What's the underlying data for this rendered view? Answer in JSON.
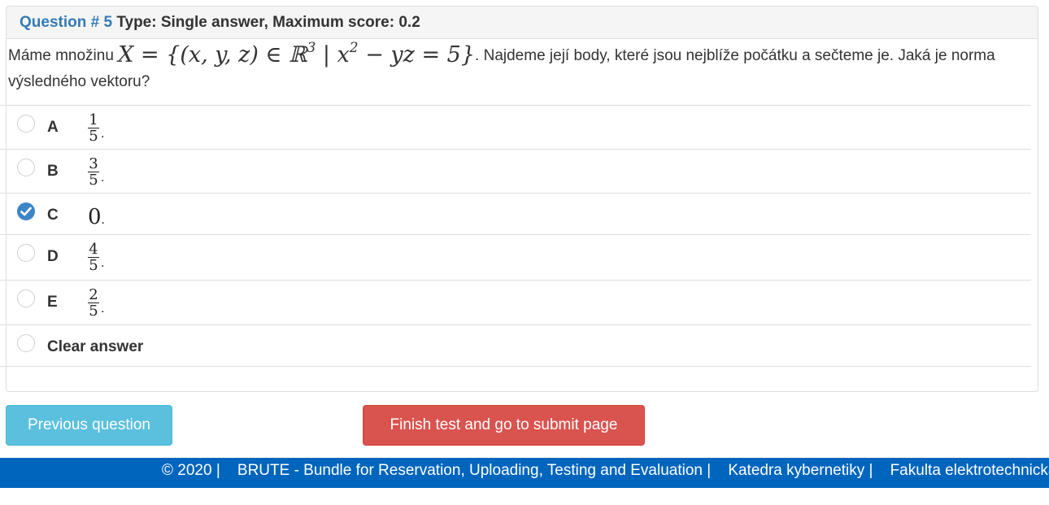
{
  "question": {
    "number_label": "Question # 5",
    "type_label": "Type: Single answer, Maximum score: 0.2",
    "text_before": "Máme množinu ",
    "math_set": "X = {(x, y, z) ∈ ℝ",
    "math_exp": "3",
    "math_mid": " | x",
    "math_exp2": "2",
    "math_end": " − yz = 5}",
    "text_after": ". Najdeme její body, které jsou nejblíže počátku a sečteme je. Jaká je norma výsledného vektoru?"
  },
  "options": [
    {
      "letter": "A",
      "numerator": "1",
      "denominator": "5",
      "selected": false
    },
    {
      "letter": "B",
      "numerator": "3",
      "denominator": "5",
      "selected": false
    },
    {
      "letter": "C",
      "value": "0",
      "selected": true
    },
    {
      "letter": "D",
      "numerator": "4",
      "denominator": "5",
      "selected": false
    },
    {
      "letter": "E",
      "numerator": "2",
      "denominator": "5",
      "selected": false
    }
  ],
  "clear_label": "Clear answer",
  "buttons": {
    "previous": "Previous question",
    "finish": "Finish test and go to submit page"
  },
  "footer": {
    "copyright": "© 2020 |",
    "brute": "BRUTE - Bundle for Reservation, Uploading, Testing and Evaluation |",
    "katedra": "Katedra kybernetiky |",
    "fakulta": "Fakulta elektrotechnická"
  },
  "colors": {
    "question_number": "#337ab7",
    "radio_checked": "#3b86c7",
    "btn_previous": "#5bc0de",
    "btn_finish": "#d9534f",
    "footer_bg": "#0065bd"
  }
}
